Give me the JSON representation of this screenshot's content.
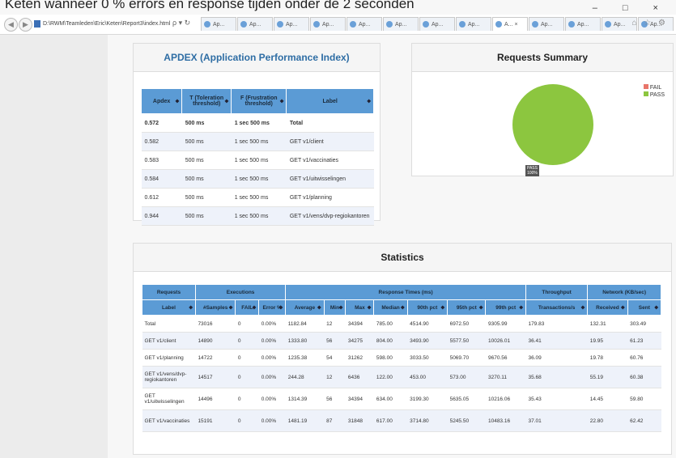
{
  "caption": "Keten wanneer 0 % errors en response tijden onder de 2 seconden",
  "window_controls": "– □ ×",
  "toolbar": {
    "url": "D:\\RWM\\Teamleden\\Eric\\Keten\\Report3\\index.html",
    "url_tools": "ρ ▾ ↻",
    "tabs": [
      "Ap...",
      "Ap...",
      "Ap...",
      "Ap...",
      "Ap...",
      "Ap...",
      "Ap...",
      "Ap...",
      "A...  ×",
      "Ap...",
      "Ap...",
      "Ap...",
      "Ap..."
    ],
    "icons": "⌂ ☆ ⚙"
  },
  "apdex": {
    "title": "APDEX (Application Performance Index)",
    "headers": [
      "Apdex",
      "T (Toleration threshold)",
      "F (Frustration threshold)",
      "Label"
    ],
    "rows": [
      [
        "0.572",
        "500 ms",
        "1 sec 500 ms",
        "Total"
      ],
      [
        "0.582",
        "500 ms",
        "1 sec 500 ms",
        "GET v1/client"
      ],
      [
        "0.583",
        "500 ms",
        "1 sec 500 ms",
        "GET v1/vaccinaties"
      ],
      [
        "0.584",
        "500 ms",
        "1 sec 500 ms",
        "GET v1/uitwisselingen"
      ],
      [
        "0.612",
        "500 ms",
        "1 sec 500 ms",
        "GET v1/planning"
      ],
      [
        "0.944",
        "500 ms",
        "1 sec 500 ms",
        "GET v1/vens/dvp-regiokantoren"
      ]
    ]
  },
  "summary": {
    "title": "Requests Summary",
    "legend": [
      {
        "label": "FAIL",
        "color": "#e8756a"
      },
      {
        "label": "PASS",
        "color": "#8cc63f"
      }
    ],
    "pie_label": "PASS",
    "pie_percent": "100%",
    "pass_fraction": 1.0
  },
  "stats": {
    "title": "Statistics",
    "groups": [
      "Requests",
      "Executions",
      "Response Times (ms)",
      "Throughput",
      "Network (KB/sec)"
    ],
    "headers": [
      "Label",
      "#Samples",
      "FAIL",
      "Error %",
      "Average",
      "Min",
      "Max",
      "Median",
      "90th pct",
      "95th pct",
      "99th pct",
      "Transactions/s",
      "Received",
      "Sent"
    ],
    "rows": [
      [
        "Total",
        "73016",
        "0",
        "0.00%",
        "1182.84",
        "12",
        "34394",
        "785.00",
        "4514.90",
        "6972.50",
        "9305.99",
        "179.83",
        "132.31",
        "303.49"
      ],
      [
        "GET v1/client",
        "14890",
        "0",
        "0.00%",
        "1333.80",
        "56",
        "34275",
        "804.00",
        "3493.90",
        "5577.50",
        "10026.01",
        "36.41",
        "19.95",
        "61.23"
      ],
      [
        "GET v1/planning",
        "14722",
        "0",
        "0.00%",
        "1235.38",
        "54",
        "31262",
        "598.00",
        "3033.50",
        "5069.70",
        "9670.56",
        "36.09",
        "19.78",
        "60.76"
      ],
      [
        "GET v1/vens/dvp-regiokantoren",
        "14517",
        "0",
        "0.00%",
        "244.28",
        "12",
        "6436",
        "122.00",
        "453.00",
        "573.00",
        "3270.11",
        "35.68",
        "55.19",
        "60.38"
      ],
      [
        "GET v1/uitwisselingen",
        "14496",
        "0",
        "0.00%",
        "1314.39",
        "56",
        "34394",
        "634.00",
        "3199.30",
        "5635.05",
        "10216.06",
        "35.43",
        "14.45",
        "59.80"
      ],
      [
        "GET v1/vaccinaties",
        "15191",
        "0",
        "0.00%",
        "1481.19",
        "87",
        "31848",
        "617.00",
        "3714.80",
        "5245.50",
        "10483.16",
        "37.01",
        "22.80",
        "62.42"
      ]
    ]
  }
}
